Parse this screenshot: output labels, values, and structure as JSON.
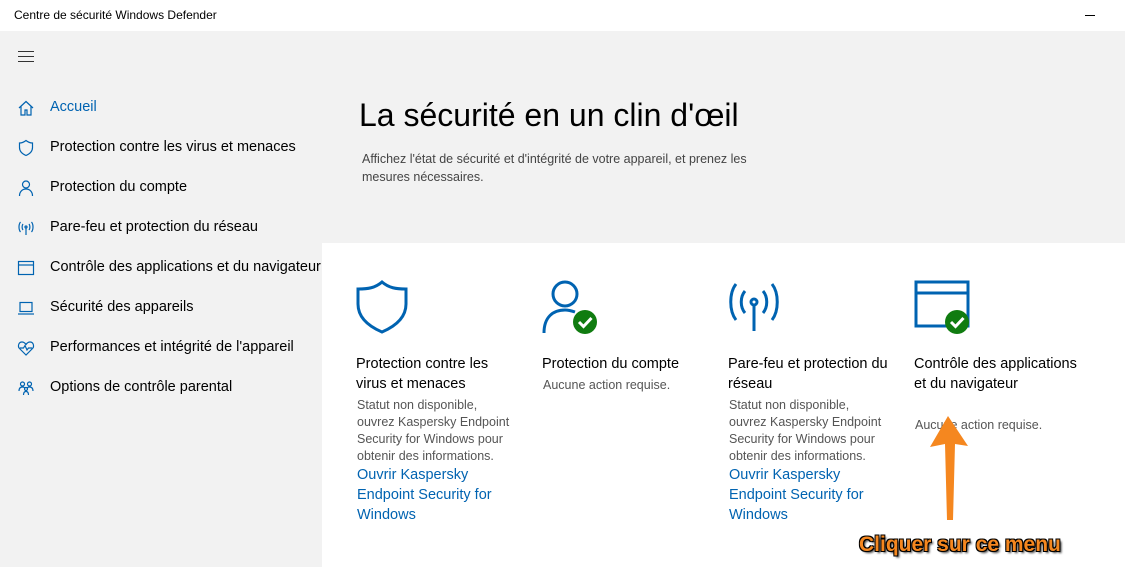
{
  "window": {
    "title": "Centre de sécurité Windows Defender"
  },
  "sidebar": {
    "items": [
      {
        "label": "Accueil",
        "icon": "home-icon"
      },
      {
        "label": "Protection contre les virus et menaces",
        "icon": "shield-icon"
      },
      {
        "label": "Protection du compte",
        "icon": "person-icon"
      },
      {
        "label": "Pare-feu et protection du réseau",
        "icon": "antenna-icon"
      },
      {
        "label": "Contrôle des applications et du navigateur",
        "icon": "browser-window-icon"
      },
      {
        "label": "Sécurité des appareils",
        "icon": "laptop-icon"
      },
      {
        "label": "Performances et intégrité de l'appareil",
        "icon": "heart-pulse-icon"
      },
      {
        "label": "Options de contrôle parental",
        "icon": "family-icon"
      }
    ]
  },
  "main": {
    "title": "La sécurité en un clin d'œil",
    "subtitle": "Affichez l'état de sécurité et d'intégrité de votre appareil, et prenez les mesures nécessaires.",
    "cards": [
      {
        "title": "Protection contre les virus et menaces",
        "status": "Statut non disponible, ouvrez Kaspersky Endpoint Security for Windows pour obtenir des informations.",
        "link": "Ouvrir Kaspersky Endpoint Security for Windows",
        "icon": "shield-icon"
      },
      {
        "title": "Protection du compte",
        "status": "Aucune action requise.",
        "icon": "person-check-icon"
      },
      {
        "title": "Pare-feu et protection du réseau",
        "status": "Statut non disponible, ouvrez Kaspersky Endpoint Security for Windows pour obtenir des informations.",
        "link": "Ouvrir Kaspersky Endpoint Security for Windows",
        "icon": "antenna-icon"
      },
      {
        "title": "Contrôle des applications et du navigateur",
        "status": "Aucune action requise.",
        "icon": "browser-window-check-icon"
      }
    ]
  },
  "annotation": {
    "label": "Cliquer sur ce menu"
  },
  "colors": {
    "accent": "#0063b1",
    "ok": "#107c10",
    "annotation": "#f5871f"
  }
}
